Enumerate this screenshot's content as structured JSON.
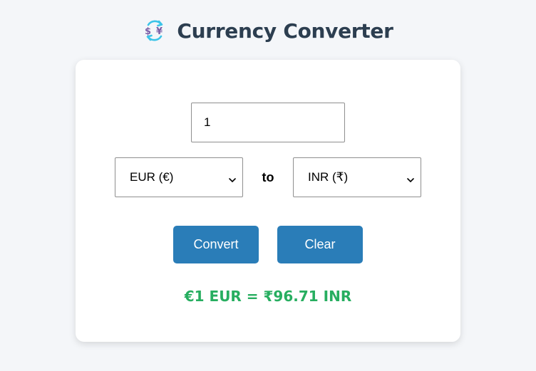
{
  "header": {
    "icon": "currency-exchange-icon",
    "title": "Currency Converter"
  },
  "form": {
    "amount_value": "1",
    "from_currency": "EUR (€)",
    "to_label": "to",
    "to_currency": "INR (₹)",
    "convert_label": "Convert",
    "clear_label": "Clear"
  },
  "result": {
    "text": "€1 EUR = ₹96.71 INR"
  },
  "colors": {
    "title": "#2c3e50",
    "button": "#2a7db8",
    "result": "#27ae60",
    "background": "#f4f6f9",
    "icon_purple": "#7b5ea7",
    "icon_cyan": "#3cc4e8"
  }
}
